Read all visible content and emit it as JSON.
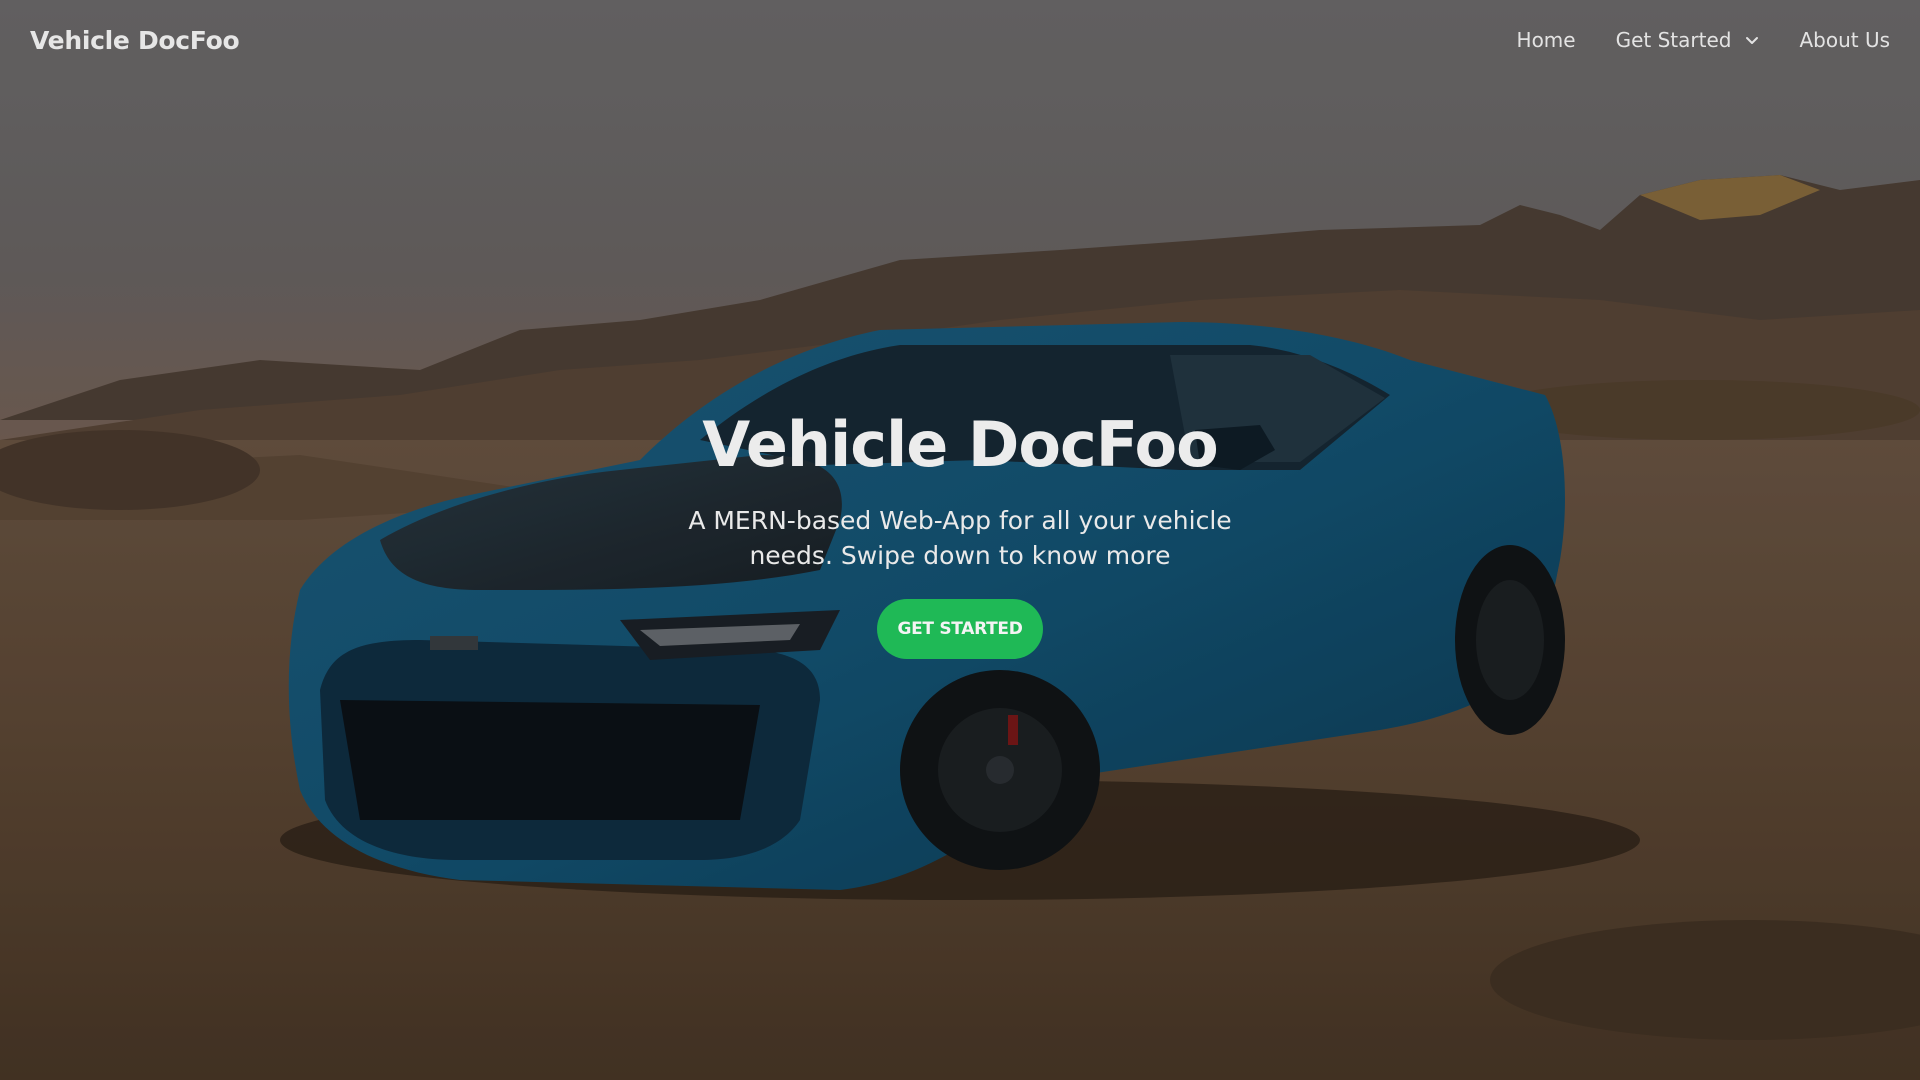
{
  "nav": {
    "brand": "Vehicle DocFoo",
    "items": [
      {
        "label": "Home"
      },
      {
        "label": "Get Started",
        "icon": "chevron-down-icon"
      },
      {
        "label": "About Us"
      }
    ]
  },
  "hero": {
    "title": "Vehicle DocFoo",
    "subtitle": "A MERN-based Web-App for all your vehicle needs. Swipe down to know more",
    "cta_label": "GET STARTED"
  },
  "colors": {
    "accent": "#1fb956",
    "text": "#ececec"
  }
}
